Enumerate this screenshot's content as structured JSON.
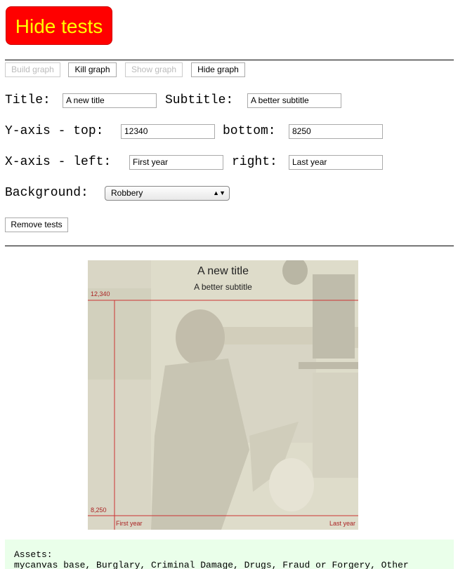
{
  "hide_tests_label": "Hide tests",
  "toolbar": {
    "build": "Build graph",
    "kill": "Kill graph",
    "show": "Show graph",
    "hide": "Hide graph"
  },
  "form": {
    "title_label": "Title:",
    "title_value": "A new title",
    "subtitle_label": "Subtitle:",
    "subtitle_value": "A better subtitle",
    "yaxis_label": "Y-axis - top:",
    "yaxis_top_value": "12340",
    "bottom_label": "bottom:",
    "yaxis_bottom_value": "8250",
    "xaxis_label": "X-axis - left:",
    "xaxis_left_value": "First year",
    "right_label": "right:",
    "xaxis_right_value": "Last year",
    "background_label": "Background:",
    "background_selected": "Robbery",
    "remove_tests": "Remove tests"
  },
  "graph": {
    "title": "A new title",
    "subtitle": "A better subtitle",
    "y_top": "12,340",
    "y_bottom": "8,250",
    "x_left": "First year",
    "x_right": "Last year",
    "axis_color": "#cc3333",
    "label_color": "#aa2222"
  },
  "assets": {
    "heading": "Assets:",
    "list": "mycanvas base, Burglary, Criminal Damage, Drugs, Fraud or Forgery, Other"
  }
}
